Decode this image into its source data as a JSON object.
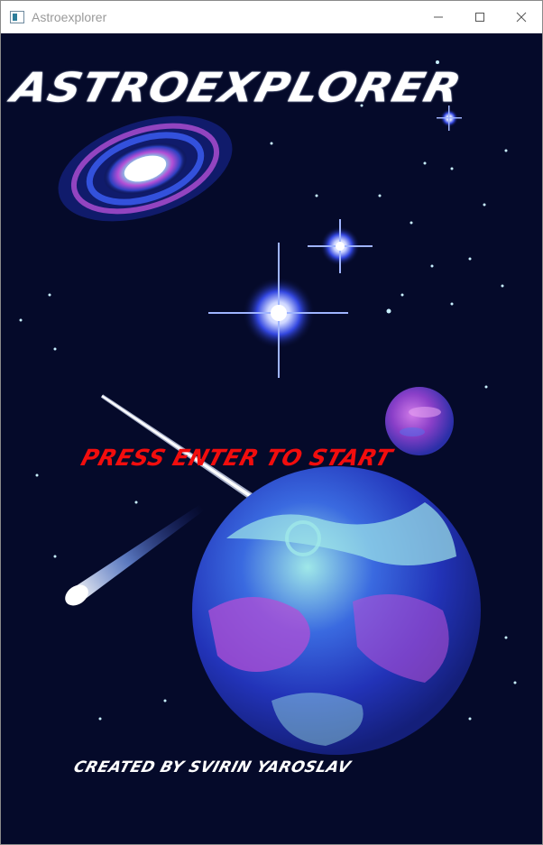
{
  "window": {
    "title": "Astroexplorer",
    "icon": "app-window-icon",
    "controls": [
      "minimize-icon",
      "maximize-icon",
      "close-icon"
    ]
  },
  "game": {
    "title": "ASTROEXPLORER",
    "start_prompt": "PRESS ENTER TO START",
    "credits": "CREATED BY SVIRIN YAROSLAV"
  },
  "colors": {
    "background": "#050a2a",
    "title_text": "#ffffff",
    "prompt_text": "#f20d0d",
    "credits_text": "#ffffff",
    "nebula_blue": "#2b4bd8",
    "nebula_magenta": "#b34fd6",
    "nebula_cyan": "#9fe8e8"
  }
}
